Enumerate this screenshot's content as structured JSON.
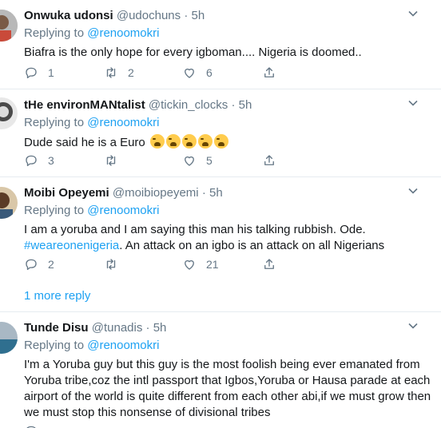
{
  "tweets": [
    {
      "name": "Onwuka udonsi",
      "handle": "@udochuns",
      "dot": "·",
      "time": "5h",
      "replying_prefix": "Replying to",
      "replying_to": "@renoomokri",
      "text": "Biafra is the only hope for every igboman.... Nigeria is doomed..",
      "replies": "1",
      "retweets": "2",
      "likes": "6"
    },
    {
      "name": "tHe environMANtalist",
      "handle": "@tickin_clocks",
      "dot": "·",
      "time": "5h",
      "replying_prefix": "Replying to",
      "replying_to": "@renoomokri",
      "text": "Dude said he is a Euro",
      "replies": "3",
      "retweets": "",
      "likes": "5"
    },
    {
      "name": "Moibi Opeyemi",
      "handle": "@moibiopeyemi",
      "dot": "·",
      "time": "5h",
      "replying_prefix": "Replying to",
      "replying_to": "@renoomokri",
      "text": "I am a yoruba and I am saying this man his talking rubbish. Ode.",
      "hashtag": "#weareonenigeria",
      "text2": ". An attack on an igbo is an attack on all Nigerians",
      "replies": "2",
      "retweets": "",
      "likes": "21"
    },
    {
      "name": "Tunde Disu",
      "handle": "@tunadis",
      "dot": "·",
      "time": "5h",
      "replying_prefix": "Replying to",
      "replying_to": "@renoomokri",
      "text": "I'm a Yoruba guy but this guy is the most foolish being ever emanated from Yoruba tribe,coz the intl passport that Igbos,Yoruba or Hausa parade at each airport of the world is quite different from each other abi,if we must grow then we must stop this nonsense of divisional tribes",
      "replies": "",
      "retweets": "",
      "likes": ""
    }
  ],
  "more_replies": "1 more reply",
  "colors": {
    "link": "#1da1f2",
    "secondary_text": "#657786",
    "divider": "#e6ecf0"
  }
}
